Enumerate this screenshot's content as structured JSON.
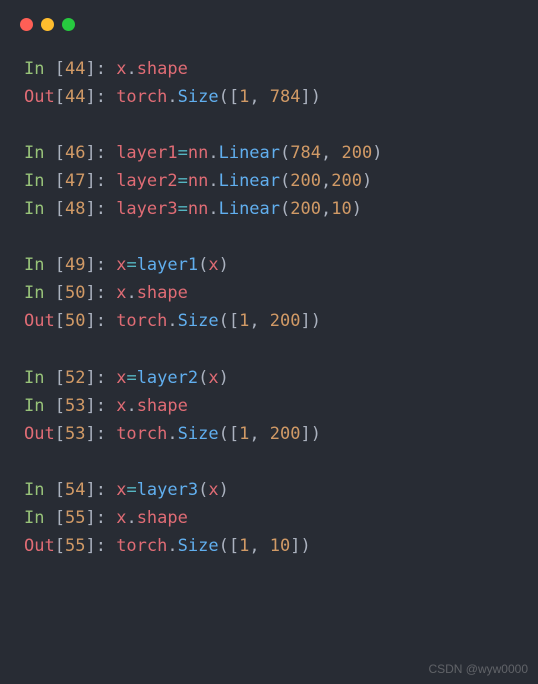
{
  "window": {
    "dots": [
      "red",
      "yellow",
      "green"
    ]
  },
  "lines": [
    {
      "type": "in",
      "n": "44",
      "seg": [
        {
          "c": "red",
          "t": "x"
        },
        {
          "c": "white",
          "t": "."
        },
        {
          "c": "red",
          "t": "shape"
        }
      ]
    },
    {
      "type": "out",
      "n": "44",
      "seg": [
        {
          "c": "red",
          "t": "torch"
        },
        {
          "c": "white",
          "t": "."
        },
        {
          "c": "blue",
          "t": "Size"
        },
        {
          "c": "white",
          "t": "(["
        },
        {
          "c": "orange",
          "t": "1"
        },
        {
          "c": "white",
          "t": ", "
        },
        {
          "c": "orange",
          "t": "784"
        },
        {
          "c": "white",
          "t": "])"
        }
      ]
    },
    {
      "type": "blank"
    },
    {
      "type": "in",
      "n": "46",
      "seg": [
        {
          "c": "red",
          "t": "layer1"
        },
        {
          "c": "cyan",
          "t": "="
        },
        {
          "c": "red",
          "t": "nn"
        },
        {
          "c": "white",
          "t": "."
        },
        {
          "c": "blue",
          "t": "Linear"
        },
        {
          "c": "white",
          "t": "("
        },
        {
          "c": "orange",
          "t": "784"
        },
        {
          "c": "white",
          "t": ", "
        },
        {
          "c": "orange",
          "t": "200"
        },
        {
          "c": "white",
          "t": ")"
        }
      ]
    },
    {
      "type": "in",
      "n": "47",
      "seg": [
        {
          "c": "red",
          "t": "layer2"
        },
        {
          "c": "cyan",
          "t": "="
        },
        {
          "c": "red",
          "t": "nn"
        },
        {
          "c": "white",
          "t": "."
        },
        {
          "c": "blue",
          "t": "Linear"
        },
        {
          "c": "white",
          "t": "("
        },
        {
          "c": "orange",
          "t": "200"
        },
        {
          "c": "white",
          "t": ","
        },
        {
          "c": "orange",
          "t": "200"
        },
        {
          "c": "white",
          "t": ")"
        }
      ]
    },
    {
      "type": "in",
      "n": "48",
      "seg": [
        {
          "c": "red",
          "t": "layer3"
        },
        {
          "c": "cyan",
          "t": "="
        },
        {
          "c": "red",
          "t": "nn"
        },
        {
          "c": "white",
          "t": "."
        },
        {
          "c": "blue",
          "t": "Linear"
        },
        {
          "c": "white",
          "t": "("
        },
        {
          "c": "orange",
          "t": "200"
        },
        {
          "c": "white",
          "t": ","
        },
        {
          "c": "orange",
          "t": "10"
        },
        {
          "c": "white",
          "t": ")"
        }
      ]
    },
    {
      "type": "blank"
    },
    {
      "type": "in",
      "n": "49",
      "seg": [
        {
          "c": "red",
          "t": "x"
        },
        {
          "c": "cyan",
          "t": "="
        },
        {
          "c": "blue",
          "t": "layer1"
        },
        {
          "c": "white",
          "t": "("
        },
        {
          "c": "red",
          "t": "x"
        },
        {
          "c": "white",
          "t": ")"
        }
      ]
    },
    {
      "type": "in",
      "n": "50",
      "seg": [
        {
          "c": "red",
          "t": "x"
        },
        {
          "c": "white",
          "t": "."
        },
        {
          "c": "red",
          "t": "shape"
        }
      ]
    },
    {
      "type": "out",
      "n": "50",
      "seg": [
        {
          "c": "red",
          "t": "torch"
        },
        {
          "c": "white",
          "t": "."
        },
        {
          "c": "blue",
          "t": "Size"
        },
        {
          "c": "white",
          "t": "(["
        },
        {
          "c": "orange",
          "t": "1"
        },
        {
          "c": "white",
          "t": ", "
        },
        {
          "c": "orange",
          "t": "200"
        },
        {
          "c": "white",
          "t": "])"
        }
      ]
    },
    {
      "type": "blank"
    },
    {
      "type": "in",
      "n": "52",
      "seg": [
        {
          "c": "red",
          "t": "x"
        },
        {
          "c": "cyan",
          "t": "="
        },
        {
          "c": "blue",
          "t": "layer2"
        },
        {
          "c": "white",
          "t": "("
        },
        {
          "c": "red",
          "t": "x"
        },
        {
          "c": "white",
          "t": ")"
        }
      ]
    },
    {
      "type": "in",
      "n": "53",
      "seg": [
        {
          "c": "red",
          "t": "x"
        },
        {
          "c": "white",
          "t": "."
        },
        {
          "c": "red",
          "t": "shape"
        }
      ]
    },
    {
      "type": "out",
      "n": "53",
      "seg": [
        {
          "c": "red",
          "t": "torch"
        },
        {
          "c": "white",
          "t": "."
        },
        {
          "c": "blue",
          "t": "Size"
        },
        {
          "c": "white",
          "t": "(["
        },
        {
          "c": "orange",
          "t": "1"
        },
        {
          "c": "white",
          "t": ", "
        },
        {
          "c": "orange",
          "t": "200"
        },
        {
          "c": "white",
          "t": "])"
        }
      ]
    },
    {
      "type": "blank"
    },
    {
      "type": "in",
      "n": "54",
      "seg": [
        {
          "c": "red",
          "t": "x"
        },
        {
          "c": "cyan",
          "t": "="
        },
        {
          "c": "blue",
          "t": "layer3"
        },
        {
          "c": "white",
          "t": "("
        },
        {
          "c": "red",
          "t": "x"
        },
        {
          "c": "white",
          "t": ")"
        }
      ]
    },
    {
      "type": "in",
      "n": "55",
      "seg": [
        {
          "c": "red",
          "t": "x"
        },
        {
          "c": "white",
          "t": "."
        },
        {
          "c": "red",
          "t": "shape"
        }
      ]
    },
    {
      "type": "out",
      "n": "55",
      "seg": [
        {
          "c": "red",
          "t": "torch"
        },
        {
          "c": "white",
          "t": "."
        },
        {
          "c": "blue",
          "t": "Size"
        },
        {
          "c": "white",
          "t": "(["
        },
        {
          "c": "orange",
          "t": "1"
        },
        {
          "c": "white",
          "t": ", "
        },
        {
          "c": "orange",
          "t": "10"
        },
        {
          "c": "white",
          "t": "])"
        }
      ]
    }
  ],
  "prompt": {
    "in_prefix": "In ",
    "out_prefix": "Out",
    "sep": ": "
  },
  "watermark": "CSDN @wyw0000"
}
